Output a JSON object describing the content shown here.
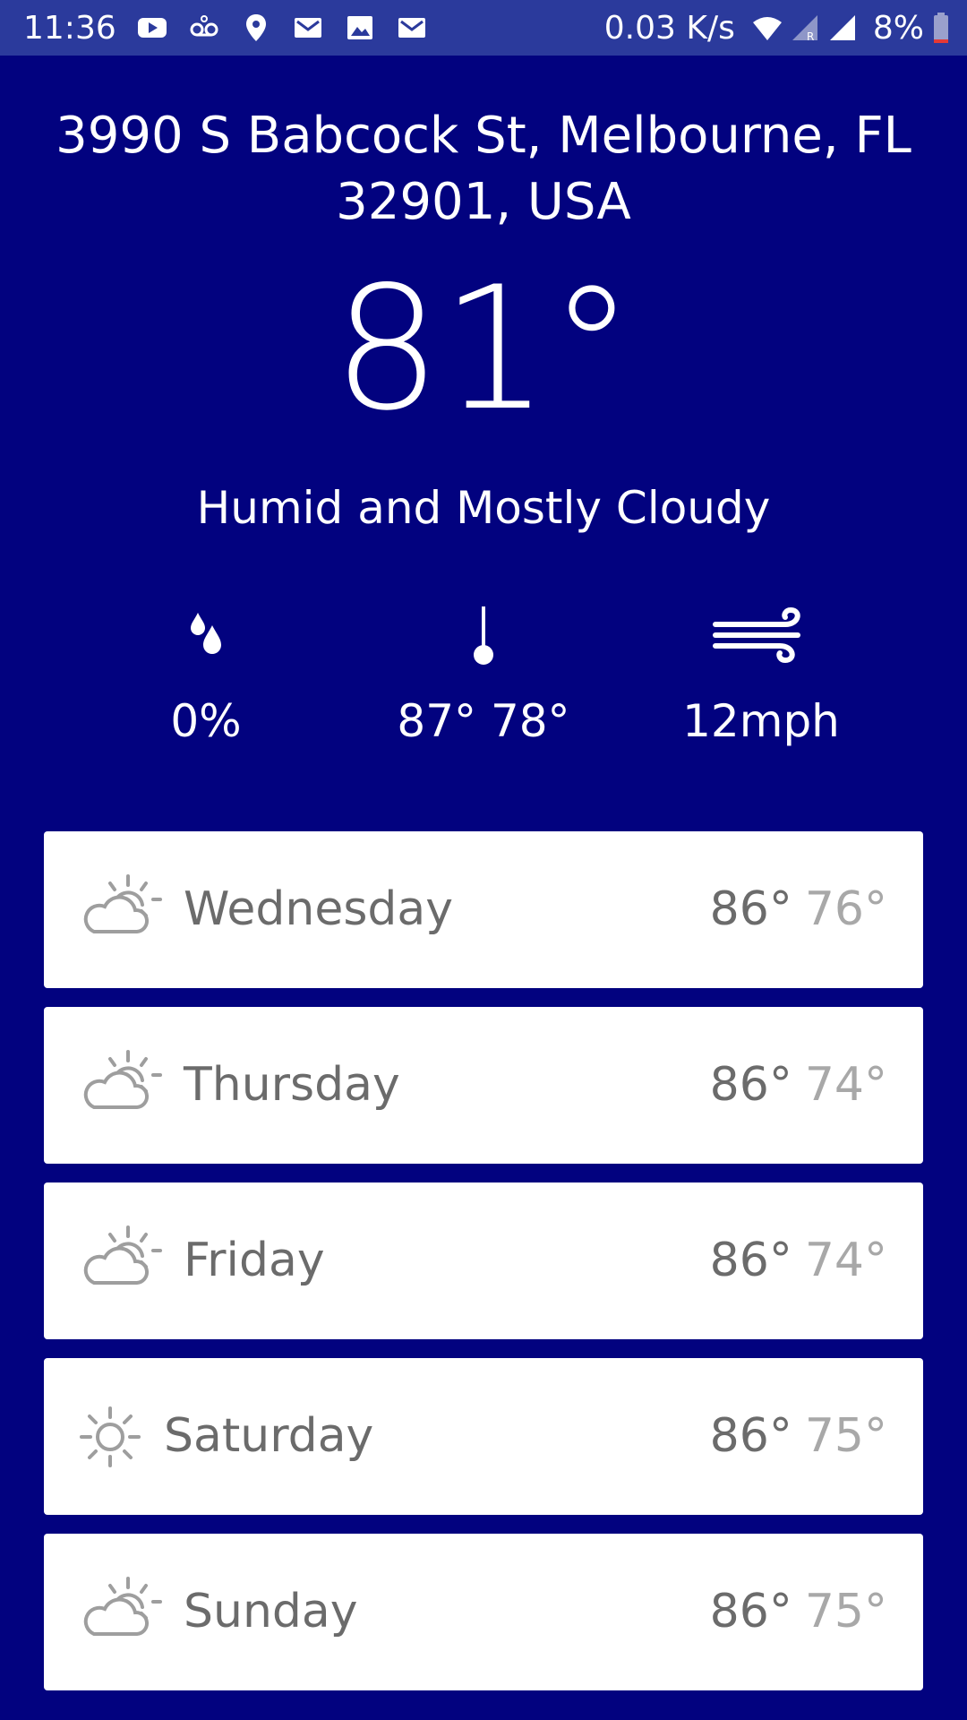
{
  "status_bar": {
    "time": "11:36",
    "speed": "0.03 K/s",
    "battery": "8%"
  },
  "location": {
    "address": "3990 S Babcock St, Melbourne, FL 32901, USA"
  },
  "current": {
    "temperature": "81°",
    "condition": "Humid and Mostly Cloudy",
    "precip": "0%",
    "high_low": "87° 78°",
    "wind": "12mph"
  },
  "forecast": [
    {
      "day": "Wednesday",
      "high": "86°",
      "low": "76°",
      "icon": "partly-cloudy-icon"
    },
    {
      "day": "Thursday",
      "high": "86°",
      "low": "74°",
      "icon": "partly-cloudy-icon"
    },
    {
      "day": "Friday",
      "high": "86°",
      "low": "74°",
      "icon": "partly-cloudy-icon"
    },
    {
      "day": "Saturday",
      "high": "86°",
      "low": "75°",
      "icon": "sun-icon"
    },
    {
      "day": "Sunday",
      "high": "86°",
      "low": "75°",
      "icon": "partly-cloudy-icon"
    }
  ],
  "colors": {
    "background": "#02027f",
    "status_bar": "#2b3a9c",
    "card": "#ffffff",
    "text_primary": "#6b6b6b",
    "text_secondary": "#a8a8a8"
  }
}
